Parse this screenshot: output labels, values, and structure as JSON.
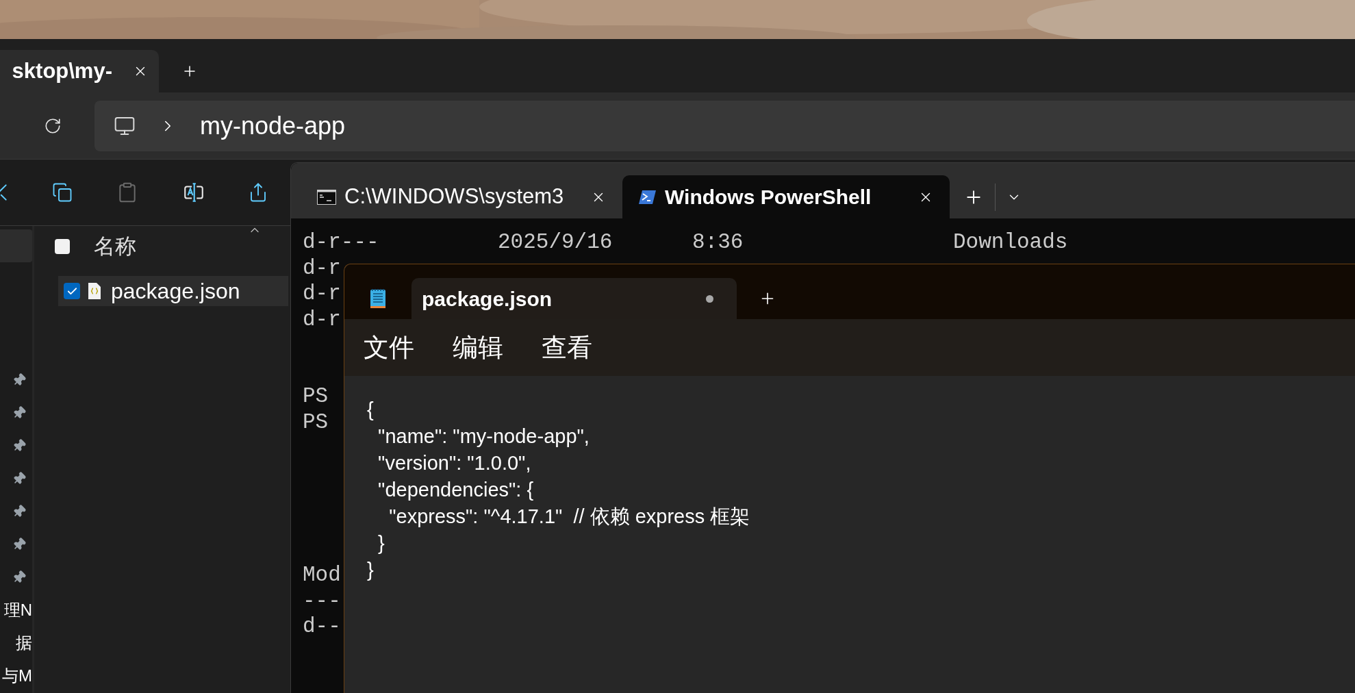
{
  "explorer": {
    "tab": {
      "title": "sktop\\my-"
    },
    "address": {
      "segments": [
        "my-node-app"
      ]
    },
    "nav_items": [
      {
        "kind": "blank",
        "selected": true
      },
      {
        "kind": "pinned",
        "selected": false
      },
      {
        "kind": "pinned",
        "selected": false
      },
      {
        "kind": "pinned",
        "selected": false
      },
      {
        "kind": "pinned",
        "selected": false
      },
      {
        "kind": "pinned",
        "selected": false
      },
      {
        "kind": "pinned",
        "selected": false
      },
      {
        "kind": "pinned",
        "selected": false
      },
      {
        "kind": "text",
        "label": "理N",
        "selected": false
      },
      {
        "kind": "text",
        "label": "据",
        "selected": false
      },
      {
        "kind": "text",
        "label": "与M",
        "selected": false
      }
    ],
    "file_list": {
      "header": {
        "label": "名称",
        "checked": false
      },
      "rows": [
        {
          "name": "package.json",
          "checked": true,
          "selected": true
        }
      ]
    }
  },
  "terminal": {
    "tabs": [
      {
        "title": "C:\\WINDOWS\\system3",
        "kind": "cmd",
        "selected": false
      },
      {
        "title": "Windows PowerShell",
        "kind": "powershell",
        "selected": true
      }
    ],
    "blocks": [
      [
        [
          "d-r---",
          "2025/9/16",
          "8:36",
          "Downloads"
        ],
        [
          "d-r"
        ],
        [
          "d-r"
        ],
        [
          "d-r"
        ]
      ],
      [
        [
          "PS"
        ],
        [
          "PS"
        ]
      ],
      [
        [
          "Mod"
        ],
        [
          "---"
        ],
        [
          "d--"
        ]
      ]
    ]
  },
  "notepad": {
    "tab": {
      "title": "package.json",
      "modified": true
    },
    "menu": [
      "文件",
      "编辑",
      "查看"
    ],
    "lines": [
      "{",
      "  \"name\": \"my-node-app\",",
      "  \"version\": \"1.0.0\",",
      "  \"dependencies\": {",
      "    \"express\": \"^4.17.1\"  // 依赖 express 框架",
      "  }",
      "}"
    ]
  }
}
